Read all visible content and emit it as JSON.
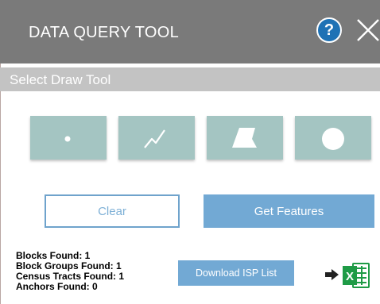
{
  "header": {
    "title": "DATA QUERY TOOL",
    "help_label": "?",
    "help_icon": "question-circle-icon",
    "close_icon": "close-x-icon"
  },
  "draw_tools": {
    "title": "Select Draw Tool",
    "tools": [
      {
        "name": "point",
        "icon": "point-icon"
      },
      {
        "name": "polyline",
        "icon": "polyline-icon"
      },
      {
        "name": "polygon",
        "icon": "polygon-icon"
      },
      {
        "name": "circle",
        "icon": "circle-icon"
      }
    ]
  },
  "actions": {
    "clear_label": "Clear",
    "get_features_label": "Get Features"
  },
  "results": {
    "blocks": "Blocks Found: 1",
    "block_groups": "Block Groups Found: 1",
    "census_tracts": "Census Tracts Found: 1",
    "anchors": "Anchors Found: 0"
  },
  "export": {
    "download_label": "Download ISP List",
    "excel_letter": "X",
    "excel_icon": "excel-icon",
    "arrow_icon": "arrow-right-icon"
  },
  "colors": {
    "header_bg": "#7a7a7a",
    "subheader_bg": "#c3c3c3",
    "tool_bg": "#a4c5c2",
    "accent": "#72a9d4",
    "help_blue": "#1f72b5",
    "excel_green": "#1f9b46"
  }
}
